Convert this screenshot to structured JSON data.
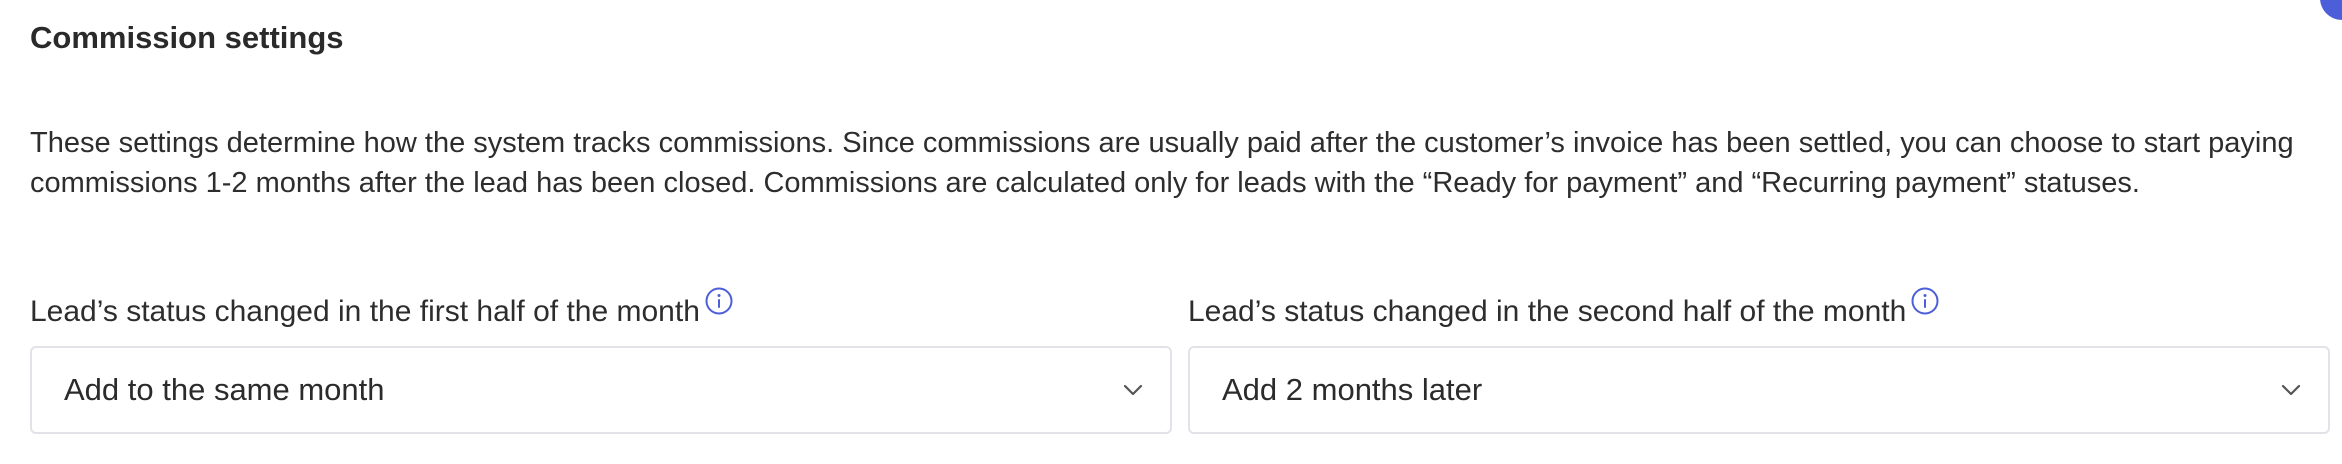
{
  "section": {
    "title": "Commission settings",
    "description": "These settings determine how the system tracks commissions. Since commissions are usually paid after the customer’s invoice has been settled, you can choose to start paying commissions 1-2 months after the lead has been closed. Commissions are calculated only for leads with the “Ready for payment” and “Recurring payment” statuses."
  },
  "fields": {
    "first_half": {
      "label": "Lead’s status changed in the first half of the month",
      "icon": "info-icon",
      "selected": "Add to the same month"
    },
    "second_half": {
      "label": "Lead’s status changed in the second half of the month",
      "icon": "info-icon",
      "selected": "Add 2 months later"
    }
  },
  "colors": {
    "accent": "#4c5ed8",
    "border": "#e2e3e8",
    "text": "#2b2b2b"
  }
}
